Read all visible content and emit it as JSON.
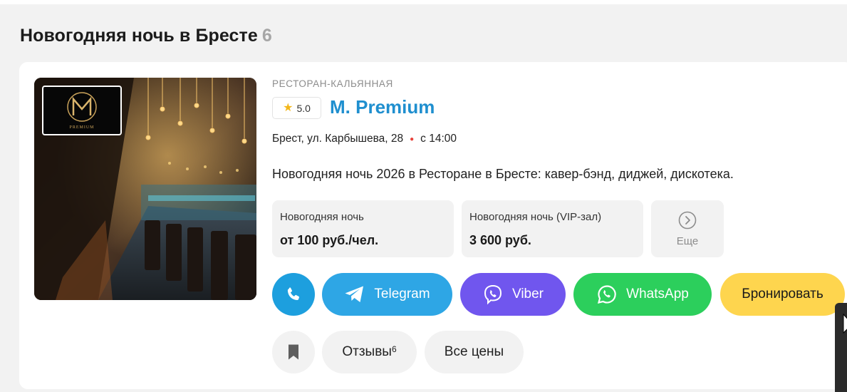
{
  "section": {
    "title": "Новогодняя ночь в Бресте",
    "count": "6"
  },
  "card": {
    "category": "РЕСТОРАН-КАЛЬЯННАЯ",
    "rating": "5.0",
    "name": "M. Premium",
    "address": "Брест, ул. Карбышева, 28",
    "time": "с 14:00",
    "description": "Новогодняя ночь 2026 в Ресторане в Бресте: кавер-бэнд, диджей, дискотека.",
    "logo_text": "PREMIUM",
    "prices": [
      {
        "label": "Новогодняя ночь",
        "value": "от 100 руб./чел."
      },
      {
        "label": "Новогодняя ночь (VIP-зал)",
        "value": "3 600 руб."
      }
    ],
    "more_label": "Еще",
    "buttons": {
      "telegram": "Telegram",
      "viber": "Viber",
      "whatsapp": "WhatsApp",
      "book": "Бронировать",
      "reviews": "Отзывы",
      "reviews_count": "6",
      "all_prices": "Все цены"
    }
  },
  "colors": {
    "accent": "#1f8fcf",
    "telegram": "#2ea6e5",
    "viber": "#7056ee",
    "whatsapp": "#2ccf5c",
    "book": "#fed54e",
    "phone": "#1d9fde"
  }
}
